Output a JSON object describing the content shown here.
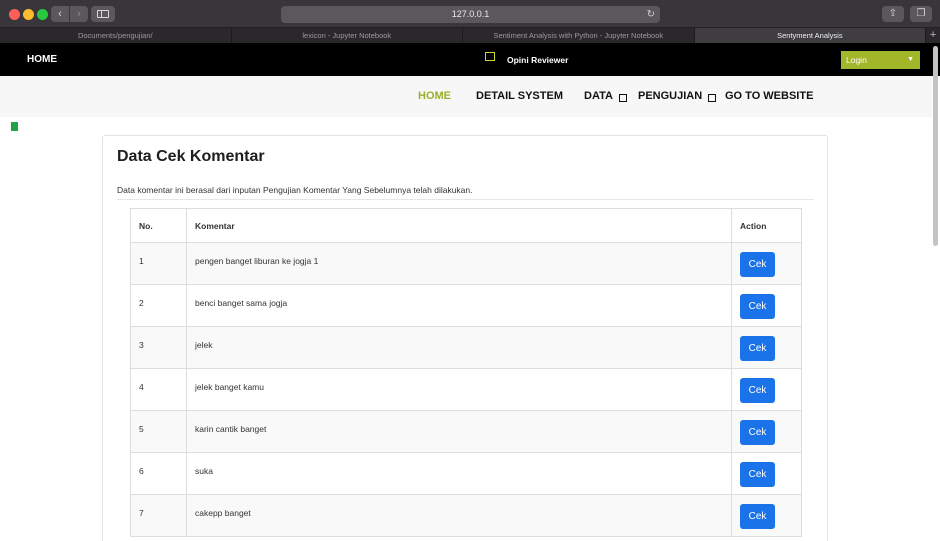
{
  "browser": {
    "url": "127.0.0.1",
    "tabs": [
      {
        "label": "Documents/pengujian/"
      },
      {
        "label": "lexicon - Jupyter Notebook"
      },
      {
        "label": "Sentiment Analysis with Python - Jupyter Notebook"
      },
      {
        "label": "Sentyment Analysis",
        "active": true
      }
    ]
  },
  "topbar": {
    "home_label": "HOME",
    "brand_label": "Opini Reviewer",
    "login_label": "Login"
  },
  "menu": {
    "home": "HOME",
    "detail_system": "DETAIL SYSTEM",
    "data": "DATA",
    "pengujian": "PENGUJIAN",
    "go_to_website": "GO TO WEBSITE"
  },
  "card": {
    "title": "Data Cek Komentar",
    "description": "Data komentar ini berasal dari inputan Pengujian Komentar Yang Sebelumnya telah dilakukan."
  },
  "table": {
    "headers": {
      "no": "No.",
      "komentar": "Komentar",
      "action": "Action"
    },
    "rows": [
      {
        "no": "1",
        "komentar": "pengen banget liburan ke jogja 1",
        "action": "Cek"
      },
      {
        "no": "2",
        "komentar": "benci banget sama jogja",
        "action": "Cek"
      },
      {
        "no": "3",
        "komentar": "jelek",
        "action": "Cek"
      },
      {
        "no": "4",
        "komentar": "jelek banget kamu",
        "action": "Cek"
      },
      {
        "no": "5",
        "komentar": "karin cantik banget",
        "action": "Cek"
      },
      {
        "no": "6",
        "komentar": "suka",
        "action": "Cek"
      },
      {
        "no": "7",
        "komentar": "cakepp banget",
        "action": "Cek"
      }
    ]
  },
  "colors": {
    "accent": "#9ab02a",
    "login_bg": "#a2b62a",
    "button_blue": "#1a73e8",
    "topbar_bg": "#000000"
  }
}
